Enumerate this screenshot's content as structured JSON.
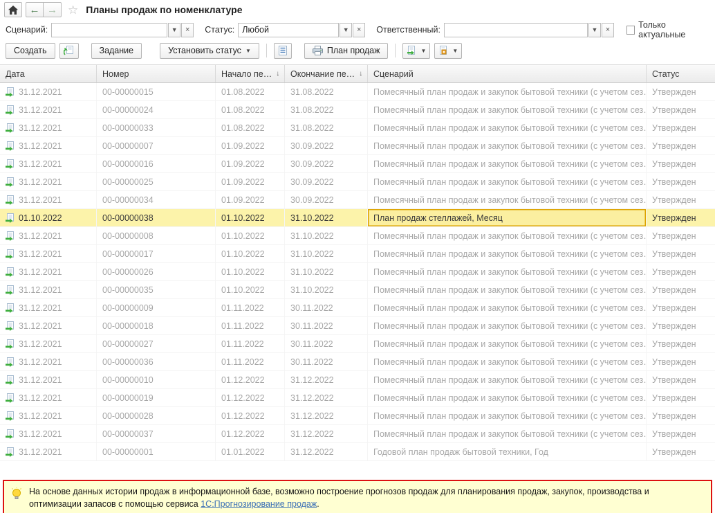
{
  "header": {
    "title": "Планы продаж по номенклатуре"
  },
  "icons": {
    "home": "⌂",
    "back": "←",
    "forward": "→",
    "star": "☆",
    "caret": "▼",
    "clear": "×",
    "sort": "↓"
  },
  "filters": {
    "scenario": {
      "label": "Сценарий:",
      "value": ""
    },
    "status": {
      "label": "Статус:",
      "value": "Любой"
    },
    "responsible": {
      "label": "Ответственный:",
      "value": ""
    },
    "only_actual": {
      "label": "Только актуальные",
      "checked": false
    }
  },
  "toolbar": {
    "create": "Создать",
    "task": "Задание",
    "set_status": "Установить статус",
    "sales_plan": "План продаж"
  },
  "table": {
    "columns": {
      "date": "Дата",
      "number": "Номер",
      "start": "Начало пе…",
      "end": "Окончание пе…",
      "scenario": "Сценарий",
      "status": "Статус"
    },
    "rows": [
      {
        "date": "31.12.2021",
        "number": "00-00000015",
        "start": "01.08.2022",
        "end": "31.08.2022",
        "scenario": "Помесячный план продаж и закупок бытовой техники (с учетом сез…",
        "status": "Утвержден",
        "selected": false
      },
      {
        "date": "31.12.2021",
        "number": "00-00000024",
        "start": "01.08.2022",
        "end": "31.08.2022",
        "scenario": "Помесячный план продаж и закупок бытовой техники (с учетом сез…",
        "status": "Утвержден",
        "selected": false
      },
      {
        "date": "31.12.2021",
        "number": "00-00000033",
        "start": "01.08.2022",
        "end": "31.08.2022",
        "scenario": "Помесячный план продаж и закупок бытовой техники (с учетом сез…",
        "status": "Утвержден",
        "selected": false
      },
      {
        "date": "31.12.2021",
        "number": "00-00000007",
        "start": "01.09.2022",
        "end": "30.09.2022",
        "scenario": "Помесячный план продаж и закупок бытовой техники (с учетом сез…",
        "status": "Утвержден",
        "selected": false
      },
      {
        "date": "31.12.2021",
        "number": "00-00000016",
        "start": "01.09.2022",
        "end": "30.09.2022",
        "scenario": "Помесячный план продаж и закупок бытовой техники (с учетом сез…",
        "status": "Утвержден",
        "selected": false
      },
      {
        "date": "31.12.2021",
        "number": "00-00000025",
        "start": "01.09.2022",
        "end": "30.09.2022",
        "scenario": "Помесячный план продаж и закупок бытовой техники (с учетом сез…",
        "status": "Утвержден",
        "selected": false
      },
      {
        "date": "31.12.2021",
        "number": "00-00000034",
        "start": "01.09.2022",
        "end": "30.09.2022",
        "scenario": "Помесячный план продаж и закупок бытовой техники (с учетом сез…",
        "status": "Утвержден",
        "selected": false
      },
      {
        "date": "01.10.2022",
        "number": "00-00000038",
        "start": "01.10.2022",
        "end": "31.10.2022",
        "scenario": "План продаж стеллажей, Месяц",
        "status": "Утвержден",
        "selected": true
      },
      {
        "date": "31.12.2021",
        "number": "00-00000008",
        "start": "01.10.2022",
        "end": "31.10.2022",
        "scenario": "Помесячный план продаж и закупок бытовой техники (с учетом сез…",
        "status": "Утвержден",
        "selected": false
      },
      {
        "date": "31.12.2021",
        "number": "00-00000017",
        "start": "01.10.2022",
        "end": "31.10.2022",
        "scenario": "Помесячный план продаж и закупок бытовой техники (с учетом сез…",
        "status": "Утвержден",
        "selected": false
      },
      {
        "date": "31.12.2021",
        "number": "00-00000026",
        "start": "01.10.2022",
        "end": "31.10.2022",
        "scenario": "Помесячный план продаж и закупок бытовой техники (с учетом сез…",
        "status": "Утвержден",
        "selected": false
      },
      {
        "date": "31.12.2021",
        "number": "00-00000035",
        "start": "01.10.2022",
        "end": "31.10.2022",
        "scenario": "Помесячный план продаж и закупок бытовой техники (с учетом сез…",
        "status": "Утвержден",
        "selected": false
      },
      {
        "date": "31.12.2021",
        "number": "00-00000009",
        "start": "01.11.2022",
        "end": "30.11.2022",
        "scenario": "Помесячный план продаж и закупок бытовой техники (с учетом сез…",
        "status": "Утвержден",
        "selected": false
      },
      {
        "date": "31.12.2021",
        "number": "00-00000018",
        "start": "01.11.2022",
        "end": "30.11.2022",
        "scenario": "Помесячный план продаж и закупок бытовой техники (с учетом сез…",
        "status": "Утвержден",
        "selected": false
      },
      {
        "date": "31.12.2021",
        "number": "00-00000027",
        "start": "01.11.2022",
        "end": "30.11.2022",
        "scenario": "Помесячный план продаж и закупок бытовой техники (с учетом сез…",
        "status": "Утвержден",
        "selected": false
      },
      {
        "date": "31.12.2021",
        "number": "00-00000036",
        "start": "01.11.2022",
        "end": "30.11.2022",
        "scenario": "Помесячный план продаж и закупок бытовой техники (с учетом сез…",
        "status": "Утвержден",
        "selected": false
      },
      {
        "date": "31.12.2021",
        "number": "00-00000010",
        "start": "01.12.2022",
        "end": "31.12.2022",
        "scenario": "Помесячный план продаж и закупок бытовой техники (с учетом сез…",
        "status": "Утвержден",
        "selected": false
      },
      {
        "date": "31.12.2021",
        "number": "00-00000019",
        "start": "01.12.2022",
        "end": "31.12.2022",
        "scenario": "Помесячный план продаж и закупок бытовой техники (с учетом сез…",
        "status": "Утвержден",
        "selected": false
      },
      {
        "date": "31.12.2021",
        "number": "00-00000028",
        "start": "01.12.2022",
        "end": "31.12.2022",
        "scenario": "Помесячный план продаж и закупок бытовой техники (с учетом сез…",
        "status": "Утвержден",
        "selected": false
      },
      {
        "date": "31.12.2021",
        "number": "00-00000037",
        "start": "01.12.2022",
        "end": "31.12.2022",
        "scenario": "Помесячный план продаж и закупок бытовой техники (с учетом сез…",
        "status": "Утвержден",
        "selected": false
      },
      {
        "date": "31.12.2021",
        "number": "00-00000001",
        "start": "01.01.2022",
        "end": "31.12.2022",
        "scenario": "Годовой план продаж бытовой техники, Год",
        "status": "Утвержден",
        "selected": false
      }
    ]
  },
  "banner": {
    "text": "На основе данных истории продаж в информационной базе, возможно построение прогнозов продаж для планирования продаж, закупок, производства и оптимизации запасов с помощью сервиса ",
    "link": "1С:Прогнозирование продаж",
    "suffix": "."
  }
}
